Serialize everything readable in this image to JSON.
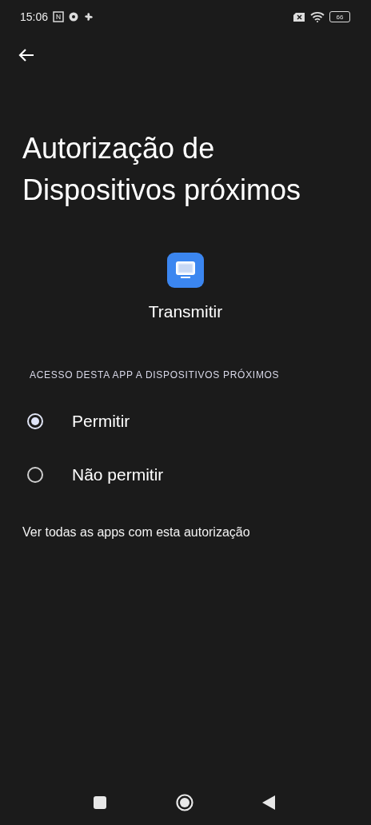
{
  "status_bar": {
    "time": "15:06",
    "battery": "66"
  },
  "title": "Autorização de Dispositivos próximos",
  "app": {
    "name": "Transmitir"
  },
  "section": {
    "header": "ACESSO DESTA APP A DISPOSITIVOS PRÓXIMOS"
  },
  "options": [
    {
      "label": "Permitir",
      "selected": true
    },
    {
      "label": "Não permitir",
      "selected": false
    }
  ],
  "link": "Ver todas as apps com esta autorização"
}
